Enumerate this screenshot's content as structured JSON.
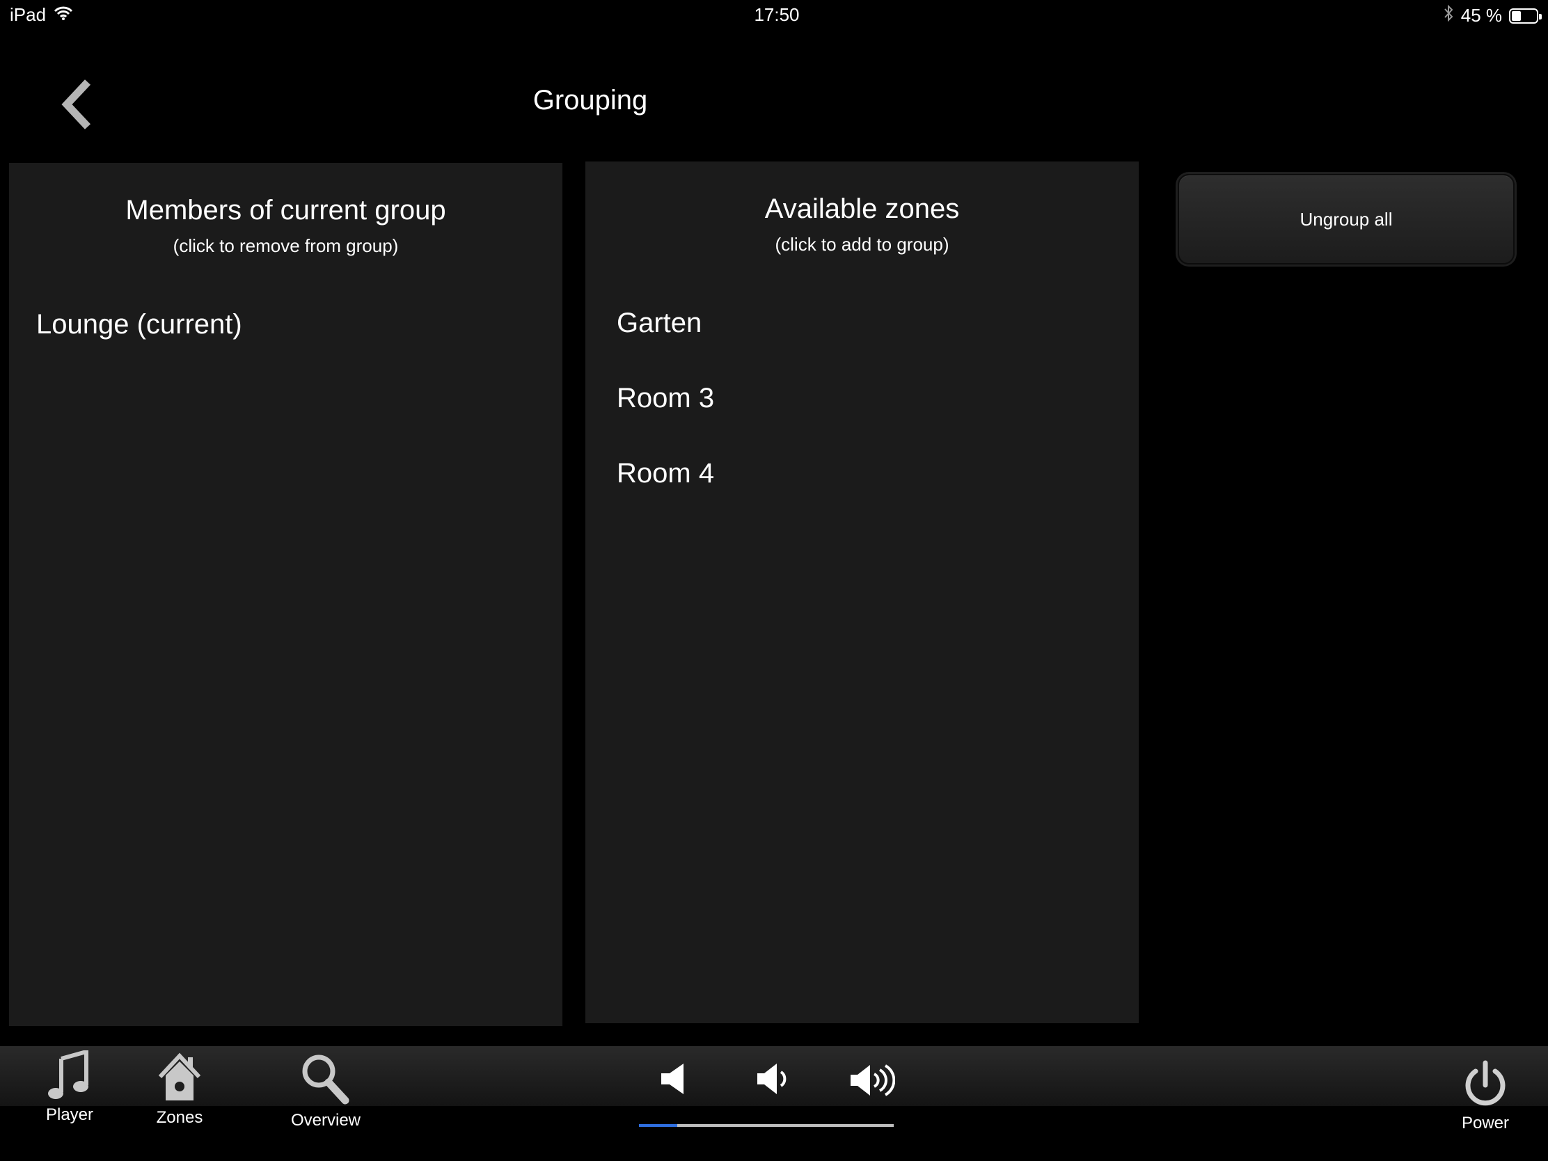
{
  "status_bar": {
    "device": "iPad",
    "time": "17:50",
    "battery_text": "45 %",
    "battery_level": 0.45,
    "icons": [
      "wifi-icon",
      "bluetooth-icon",
      "battery-icon"
    ]
  },
  "header": {
    "title": "Grouping",
    "back_icon": "chevron-left-icon"
  },
  "members_panel": {
    "title": "Members of current group",
    "subtitle": "(click to remove from group)",
    "items": [
      "Lounge (current)"
    ]
  },
  "available_panel": {
    "title": "Available zones",
    "subtitle": "(click to add to group)",
    "items": [
      "Garten",
      "Room 3",
      "Room 4"
    ]
  },
  "actions": {
    "ungroup_all_label": "Ungroup all"
  },
  "bottom_bar": {
    "nav": [
      {
        "label": "Player",
        "icon": "music-note-icon"
      },
      {
        "label": "Zones",
        "icon": "home-icon"
      },
      {
        "label": "Overview",
        "icon": "search-icon"
      }
    ],
    "volume_controls": [
      "volume-mute-icon",
      "volume-down-icon",
      "volume-up-icon"
    ],
    "volume_level": 0.15,
    "power_label": "Power",
    "power_icon": "power-icon"
  },
  "colors": {
    "background": "#000000",
    "panel": "#1b1b1b",
    "volume_accent": "#2f6fe0"
  }
}
